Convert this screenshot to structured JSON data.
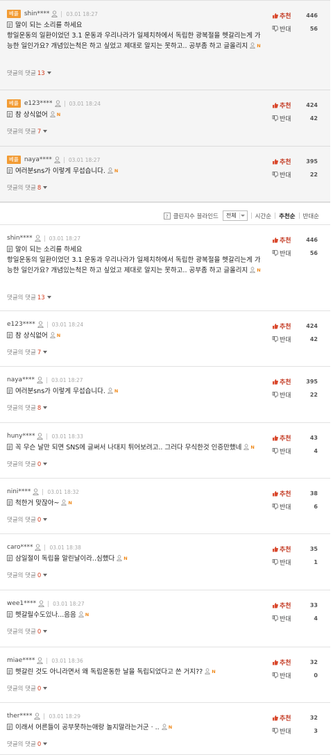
{
  "best_badge_label": "베플",
  "vote": {
    "up_label": "추천",
    "down_label": "반대"
  },
  "reply_label": "댓글의 댓글",
  "n_mark": "N",
  "best_comments": [
    {
      "nick": "shin****",
      "date": "03.01 18:27",
      "text": "말이 되는 소리를 하세요\n항일운동의 일환이었던 3.1 운동과 우리나라가 일제치하에서 독립한 광복절을 헷갈리는게 가능한 일인가요? 개념있는척은 하고 싶었고 제대로 알지는 못하고.. 공부좀 하고 글올리지",
      "replies": "13",
      "up": "446",
      "down": "56"
    },
    {
      "nick": "e123****",
      "date": "03.01 18:24",
      "text": "참 상식없어",
      "replies": "7",
      "up": "424",
      "down": "42"
    },
    {
      "nick": "naya****",
      "date": "03.01 18:27",
      "text": "여러분sns가 이렇게 무섭습니다.",
      "replies": "8",
      "up": "395",
      "down": "22"
    }
  ],
  "sortbar": {
    "help": "?",
    "clean_bot_label": "클린지수 블라인드",
    "filter_selected": "전체",
    "options": [
      "시간순",
      "추천순",
      "반대순"
    ],
    "active": "추천순"
  },
  "comments": [
    {
      "nick": "shin****",
      "date": "03.01 18:27",
      "text": "말이 되는 소리를 하세요\n항일운동의 일환이었던 3.1 운동과 우리나라가 일제치하에서 독립한 광복절을 헷갈리는게 가능한 일인가요? 개념있는척은 하고 싶었고 제대로 알지는 못하고.. 공부좀 하고 글올리지",
      "replies": "13",
      "up": "446",
      "down": "56"
    },
    {
      "nick": "e123****",
      "date": "03.01 18:24",
      "text": "참 상식없어",
      "replies": "7",
      "up": "424",
      "down": "42"
    },
    {
      "nick": "naya****",
      "date": "03.01 18:27",
      "text": "여러분sns가 이렇게 무섭습니다.",
      "replies": "8",
      "up": "395",
      "down": "22"
    },
    {
      "nick": "huny****",
      "date": "03.01 18:33",
      "text": "꼭 무슨 날만 되면 SNS에 글써서 나대지 튀어보려고.. 그러다 무식한것 인증만했네",
      "replies": "0",
      "up": "43",
      "down": "4"
    },
    {
      "nick": "nini****",
      "date": "03.01 18:32",
      "text": "척한거 맞잖아~",
      "replies": "0",
      "up": "38",
      "down": "6"
    },
    {
      "nick": "caro****",
      "date": "03.01 18:38",
      "text": "삼일절이 독립을 알린날이라..심했다",
      "replies": "0",
      "up": "35",
      "down": "1"
    },
    {
      "nick": "wee1****",
      "date": "03.01 18:27",
      "text": "헷갈릴수도있나...음음",
      "replies": "0",
      "up": "33",
      "down": "4"
    },
    {
      "nick": "miae****",
      "date": "03.01 18:36",
      "text": "헷갈린 것도 아니라면서 왜 독립운동한 날을 독립되었다고 쓴 거지??",
      "replies": "0",
      "up": "32",
      "down": "0"
    },
    {
      "nick": "ther****",
      "date": "03.01 18:29",
      "text": "이래서 어른들이 공부못하는애랑 놀지말라는거군 · ..",
      "replies": "0",
      "up": "32",
      "down": "3"
    }
  ]
}
